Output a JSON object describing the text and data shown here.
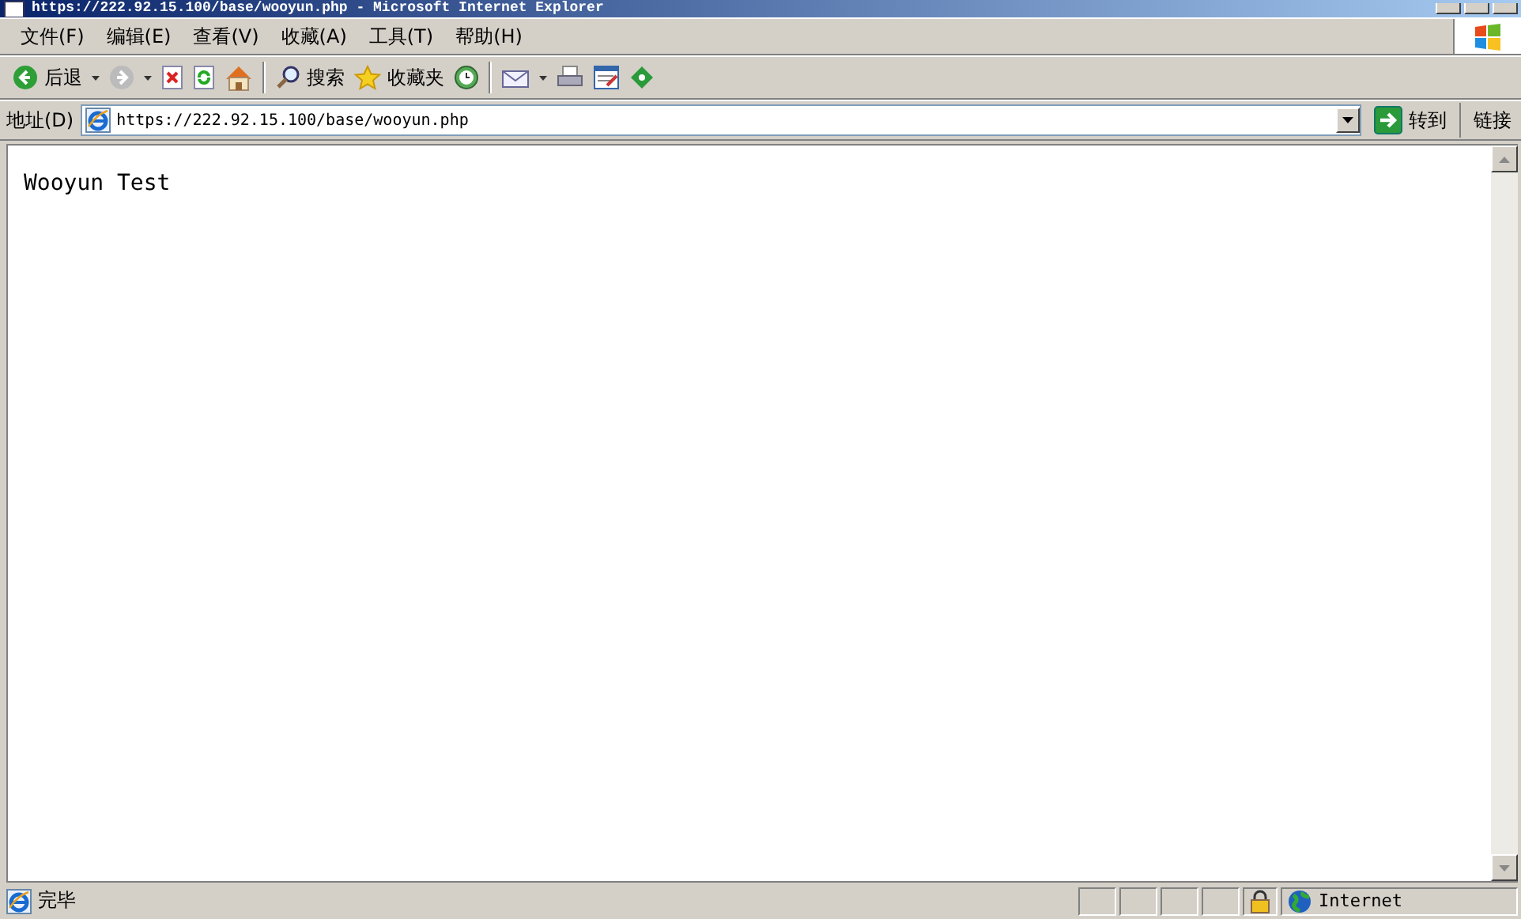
{
  "window": {
    "title": "https://222.92.15.100/base/wooyun.php - Microsoft Internet Explorer"
  },
  "menu": [
    "文件(F)",
    "编辑(E)",
    "查看(V)",
    "收藏(A)",
    "工具(T)",
    "帮助(H)"
  ],
  "toolbar": {
    "back": "后退",
    "search": "搜索",
    "favorites": "收藏夹"
  },
  "address": {
    "label": "地址(D)",
    "value": "https://222.92.15.100/base/wooyun.php",
    "go": "转到",
    "links": "链接"
  },
  "page": {
    "text": "Wooyun Test"
  },
  "status": {
    "text": "完毕",
    "zone": "Internet"
  }
}
